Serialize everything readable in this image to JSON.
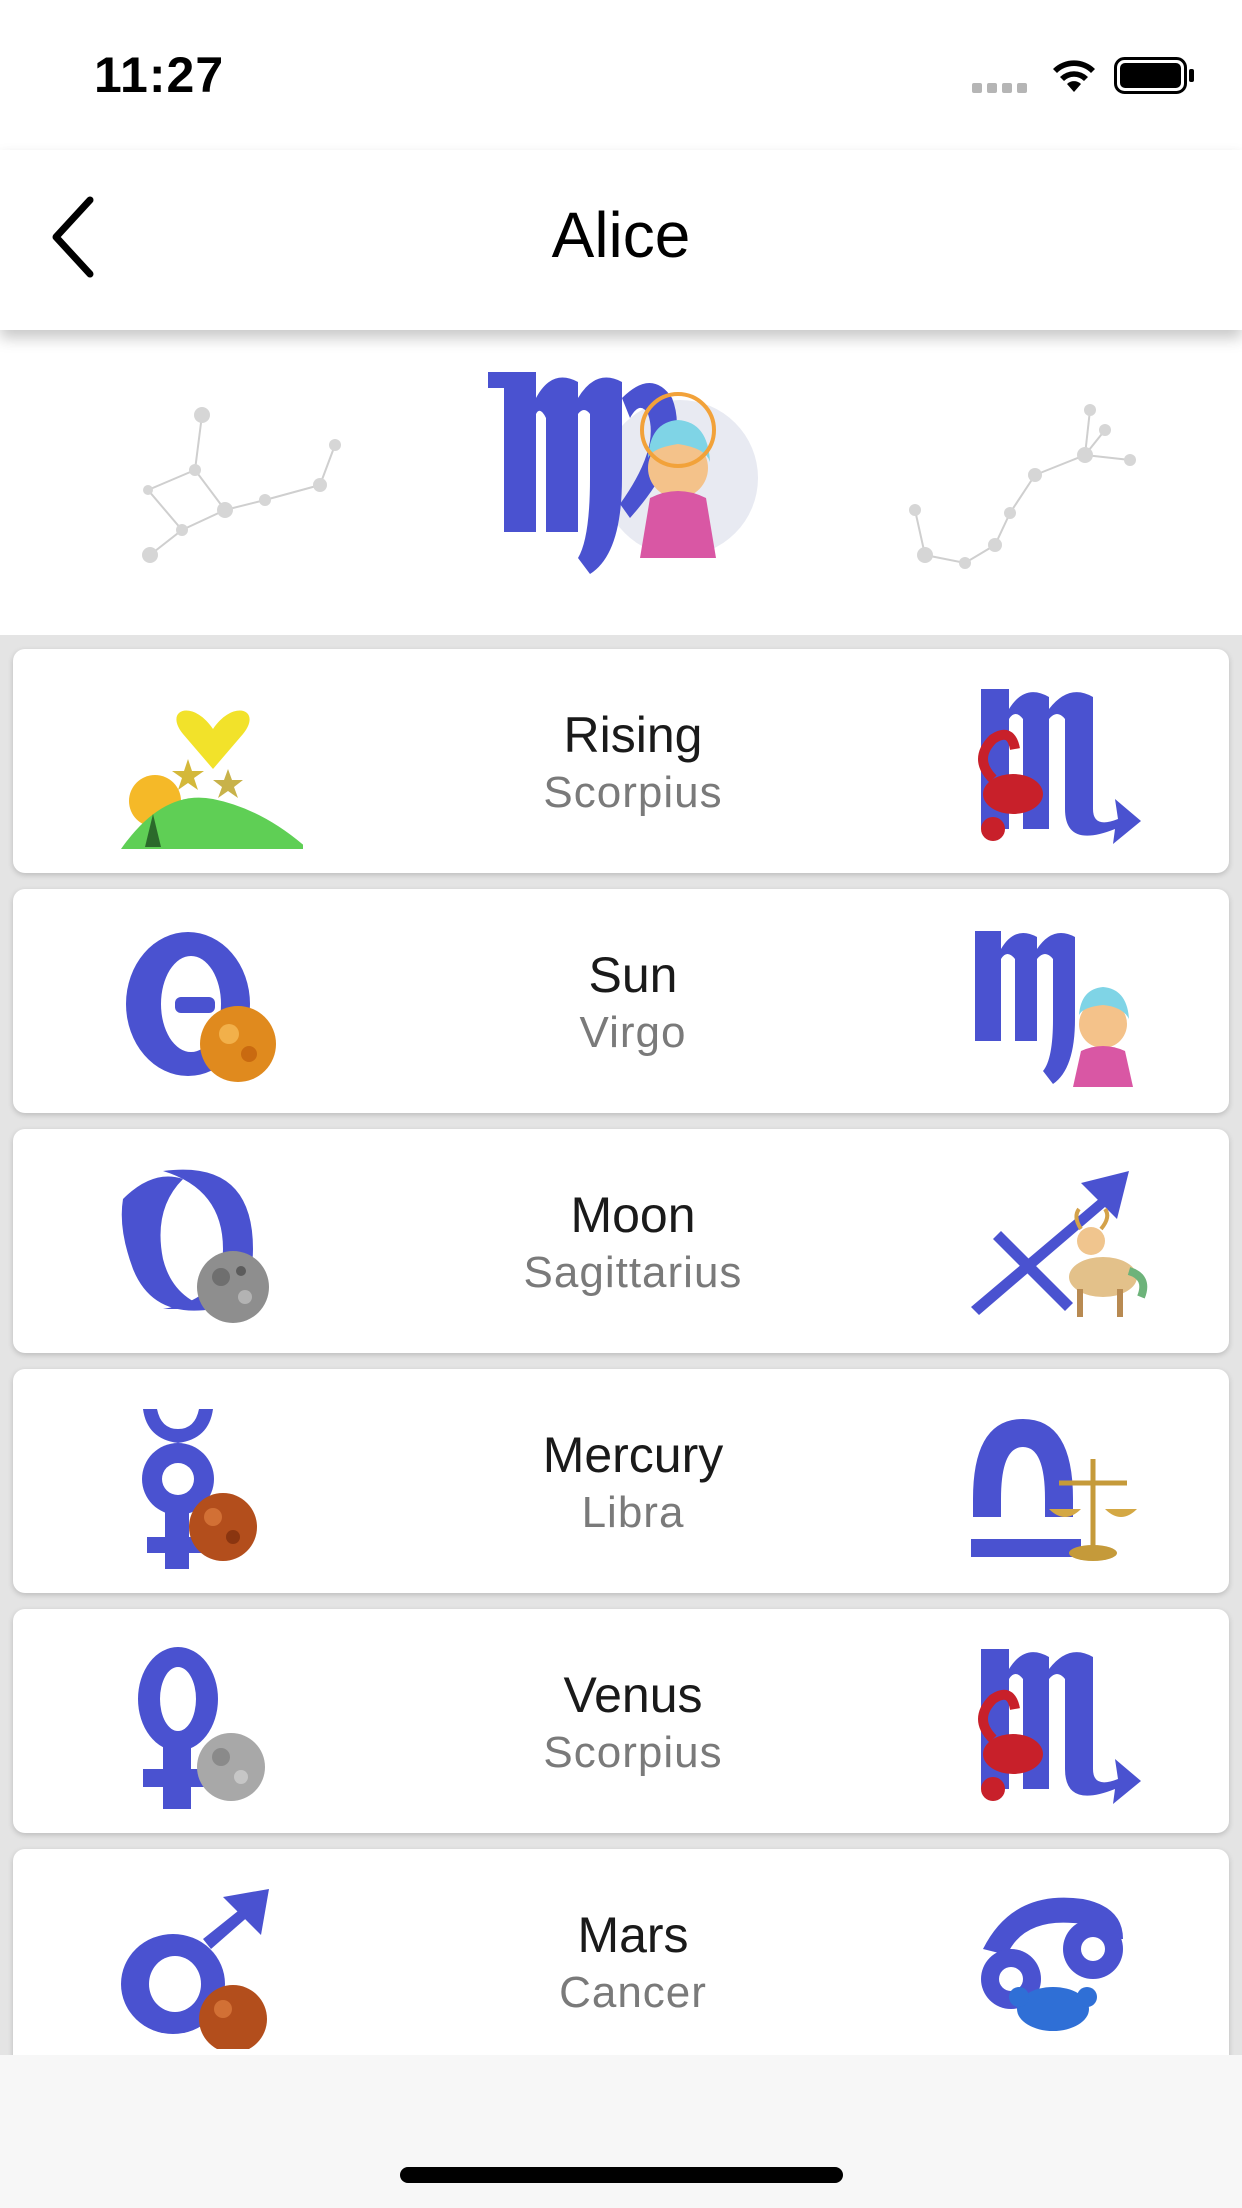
{
  "status_bar": {
    "time": "11:27"
  },
  "nav": {
    "title": "Alice"
  },
  "header": {
    "sign_icon": "virgo-sign-icon"
  },
  "placements": [
    {
      "title": "Rising",
      "sign": "Scorpius",
      "planet_icon": "rising-sun-icon",
      "sign_icon": "scorpius-sign-icon"
    },
    {
      "title": "Sun",
      "sign": "Virgo",
      "planet_icon": "sun-planet-icon",
      "sign_icon": "virgo-sign-icon"
    },
    {
      "title": "Moon",
      "sign": "Sagittarius",
      "planet_icon": "moon-planet-icon",
      "sign_icon": "sagittarius-sign-icon"
    },
    {
      "title": "Mercury",
      "sign": "Libra",
      "planet_icon": "mercury-planet-icon",
      "sign_icon": "libra-sign-icon"
    },
    {
      "title": "Venus",
      "sign": "Scorpius",
      "planet_icon": "venus-planet-icon",
      "sign_icon": "scorpius-sign-icon"
    },
    {
      "title": "Mars",
      "sign": "Cancer",
      "planet_icon": "mars-planet-icon",
      "sign_icon": "cancer-sign-icon"
    }
  ],
  "colors": {
    "glyph_blue": "#4a52d0",
    "scorpion_red": "#c8202a",
    "list_background": "#e4e4e4"
  }
}
